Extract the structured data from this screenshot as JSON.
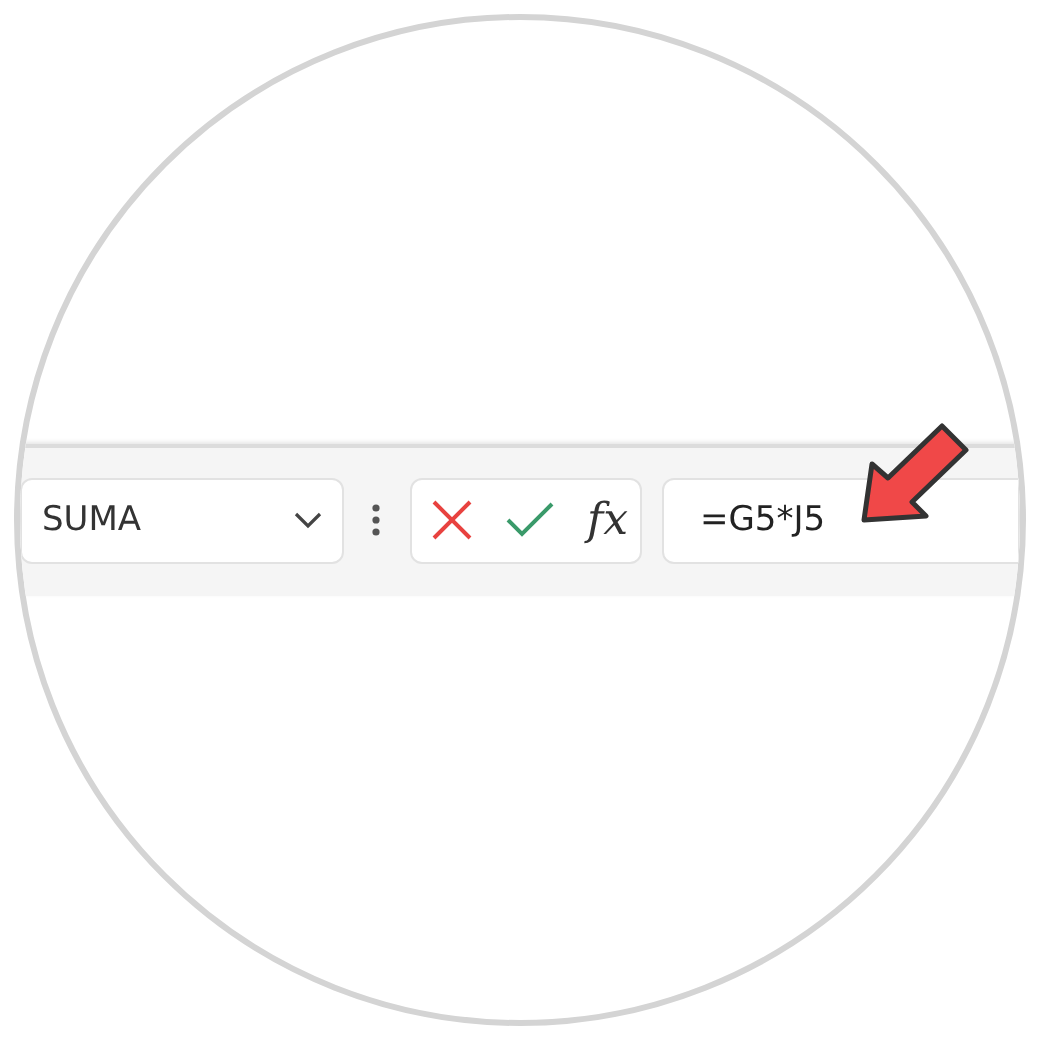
{
  "name_box": {
    "value": "SUMA"
  },
  "formula_bar": {
    "function_button": "fx",
    "formula": "=G5*J5"
  }
}
